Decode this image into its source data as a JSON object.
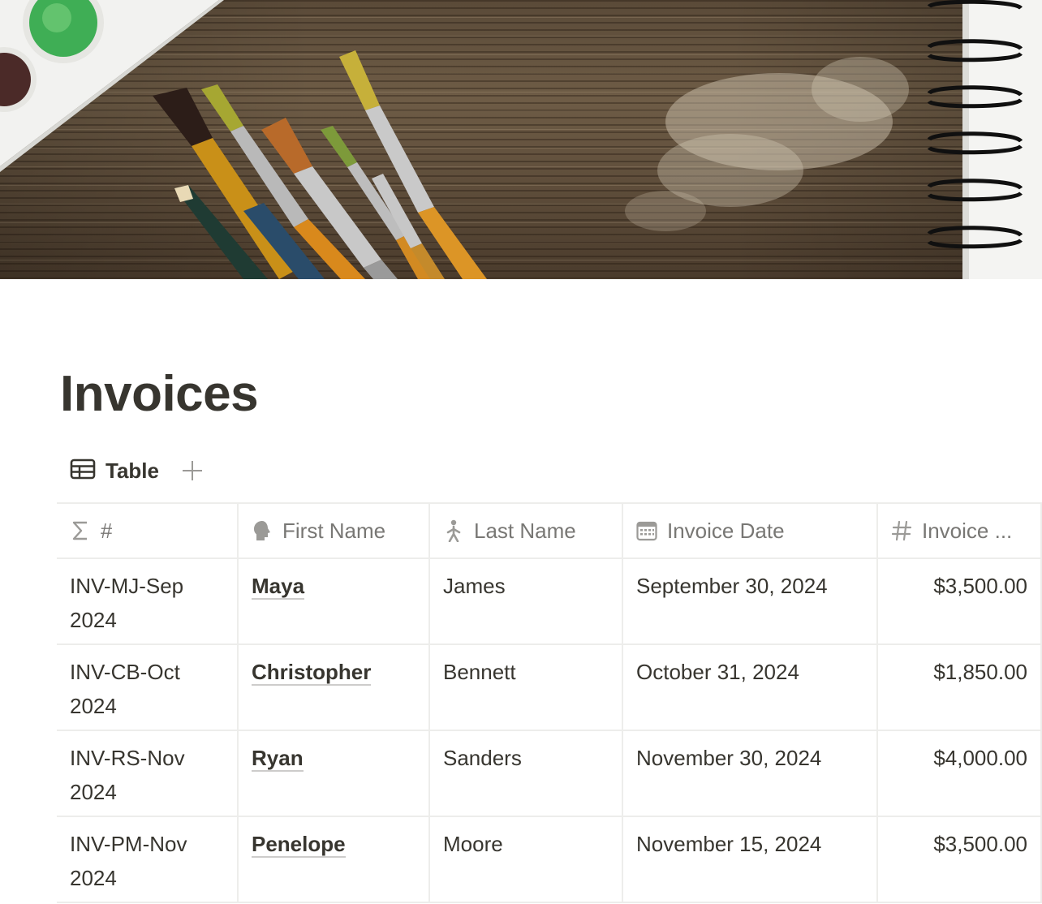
{
  "cover": {
    "image_name": "paint-brushes-on-wooden-table"
  },
  "page": {
    "title": "Invoices"
  },
  "views": {
    "tabs": [
      {
        "label": "Table",
        "icon": "table-icon"
      }
    ],
    "add_icon": "plus-icon"
  },
  "table": {
    "columns": [
      {
        "label": "#",
        "icon": "sigma-icon"
      },
      {
        "label": "First Name",
        "icon": "person-head-icon"
      },
      {
        "label": "Last Name",
        "icon": "person-walking-icon"
      },
      {
        "label": "Invoice Date",
        "icon": "calendar-icon"
      },
      {
        "label": "Invoice ...",
        "icon": "number-hash-icon"
      }
    ],
    "rows": [
      {
        "id": "INV-MJ-Sep2024",
        "first_name": "Maya",
        "last_name": "James",
        "invoice_date": "September 30, 2024",
        "amount": "$3,500.00"
      },
      {
        "id": "INV-CB-Oct2024",
        "first_name": "Christopher",
        "last_name": "Bennett",
        "invoice_date": "October 31, 2024",
        "amount": "$1,850.00"
      },
      {
        "id": "INV-RS-Nov2024",
        "first_name": "Ryan",
        "last_name": "Sanders",
        "invoice_date": "November 30, 2024",
        "amount": "$4,000.00"
      },
      {
        "id": "INV-PM-Nov2024",
        "first_name": "Penelope",
        "last_name": "Moore",
        "invoice_date": "November 15, 2024",
        "amount": "$3,500.00"
      }
    ]
  }
}
